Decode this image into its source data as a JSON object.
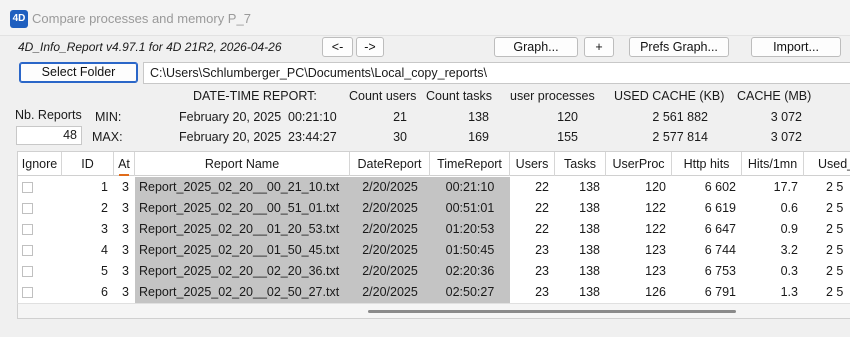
{
  "window": {
    "title": "Compare processes and memory  P_7",
    "icon": "4D"
  },
  "header": {
    "version_info": "4D_Info_Report v4.97.1 for 4D 21R2, 2026-04-26"
  },
  "toolbar": {
    "prev_label": "<-",
    "next_label": "->",
    "graph_label": "Graph...",
    "plus_label": "+",
    "prefs_graph_label": "Prefs Graph...",
    "import_label": "Import...",
    "select_folder_label": "Select Folder"
  },
  "folder_path": "C:\\Users\\Schlumberger_PC\\Documents\\Local_copy_reports\\",
  "summary": {
    "nb_reports_label": "Nb. Reports",
    "nb_reports_value": "48",
    "min_label": "MIN:",
    "max_label": "MAX:",
    "headers": {
      "datetime": "DATE-TIME REPORT:",
      "count_users": "Count users",
      "count_tasks": "Count tasks",
      "user_processes": "user processes",
      "used_cache": "USED CACHE (KB)",
      "cache": "CACHE (MB)"
    },
    "min": {
      "date": "February 20, 2025",
      "time": "00:21:10",
      "users": "21",
      "tasks": "138",
      "user_proc": "120",
      "used_cache": "2 561 882",
      "cache": "3 072"
    },
    "max": {
      "date": "February 20, 2025",
      "time": "23:44:27",
      "users": "30",
      "tasks": "169",
      "user_proc": "155",
      "used_cache": "2 577 814",
      "cache": "3 072"
    }
  },
  "table": {
    "columns": [
      "Ignore",
      "ID",
      "At",
      "Report Name",
      "DateReport",
      "TimeReport",
      "Users",
      "Tasks",
      "UserProc",
      "Http hits",
      "Hits/1mn",
      "Used_"
    ],
    "sorted_column": "At",
    "rows": [
      {
        "id": "1",
        "at": "3",
        "name": "Report_2025_02_20__00_21_10.txt",
        "date": "2/20/2025",
        "time": "00:21:10",
        "users": "22",
        "tasks": "138",
        "userproc": "120",
        "http": "6 602",
        "hits": "17.7",
        "used": "2 5"
      },
      {
        "id": "2",
        "at": "3",
        "name": "Report_2025_02_20__00_51_01.txt",
        "date": "2/20/2025",
        "time": "00:51:01",
        "users": "22",
        "tasks": "138",
        "userproc": "122",
        "http": "6 619",
        "hits": "0.6",
        "used": "2 5"
      },
      {
        "id": "3",
        "at": "3",
        "name": "Report_2025_02_20__01_20_53.txt",
        "date": "2/20/2025",
        "time": "01:20:53",
        "users": "22",
        "tasks": "138",
        "userproc": "122",
        "http": "6 647",
        "hits": "0.9",
        "used": "2 5"
      },
      {
        "id": "4",
        "at": "3",
        "name": "Report_2025_02_20__01_50_45.txt",
        "date": "2/20/2025",
        "time": "01:50:45",
        "users": "23",
        "tasks": "138",
        "userproc": "123",
        "http": "6 744",
        "hits": "3.2",
        "used": "2 5"
      },
      {
        "id": "5",
        "at": "3",
        "name": "Report_2025_02_20__02_20_36.txt",
        "date": "2/20/2025",
        "time": "02:20:36",
        "users": "23",
        "tasks": "138",
        "userproc": "123",
        "http": "6 753",
        "hits": "0.3",
        "used": "2 5"
      },
      {
        "id": "6",
        "at": "3",
        "name": "Report_2025_02_20__02_50_27.txt",
        "date": "2/20/2025",
        "time": "02:50:27",
        "users": "23",
        "tasks": "138",
        "userproc": "126",
        "http": "6 791",
        "hits": "1.3",
        "used": "2 5"
      }
    ]
  },
  "colors": {
    "accent": "#2a66c8",
    "sort_indicator": "#e06b1a",
    "gray_cells": "#c4c4c4"
  }
}
